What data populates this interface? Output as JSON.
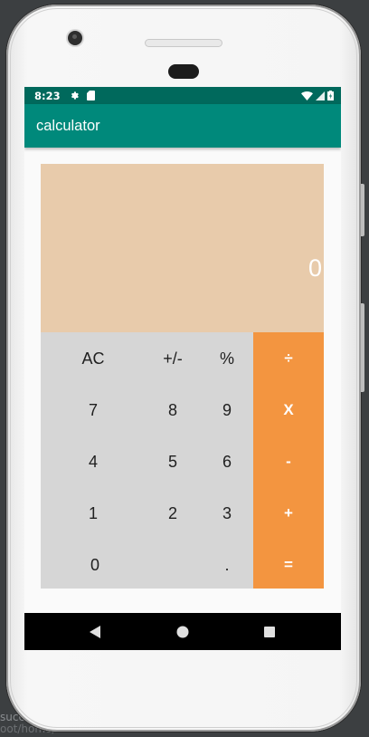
{
  "background_ide": {
    "line1": "succe",
    "line2": "oot/home/..."
  },
  "status_bar": {
    "time": "8:23",
    "icons_left": [
      "settings-gear-icon",
      "sd-card-icon"
    ],
    "icons_right": [
      "wifi-icon",
      "signal-icon",
      "battery-icon"
    ],
    "color": "#00695c"
  },
  "app_bar": {
    "title": "calculator",
    "color": "#00897b"
  },
  "calculator": {
    "display_value": "0",
    "display_color": "#e8cbab",
    "keypad_color": "#d6d6d6",
    "operator_color": "#f39540",
    "keys": {
      "ac": "AC",
      "plus_minus": "+/-",
      "percent": "%",
      "divide": "÷",
      "seven": "7",
      "eight": "8",
      "nine": "9",
      "multiply": "X",
      "four": "4",
      "five": "5",
      "six": "6",
      "minus": "-",
      "one": "1",
      "two": "2",
      "three": "3",
      "plus": "+",
      "zero": "0",
      "dot": ".",
      "equals": "="
    }
  },
  "nav_bar": {
    "buttons": [
      "back-icon",
      "home-icon",
      "recents-icon"
    ]
  }
}
